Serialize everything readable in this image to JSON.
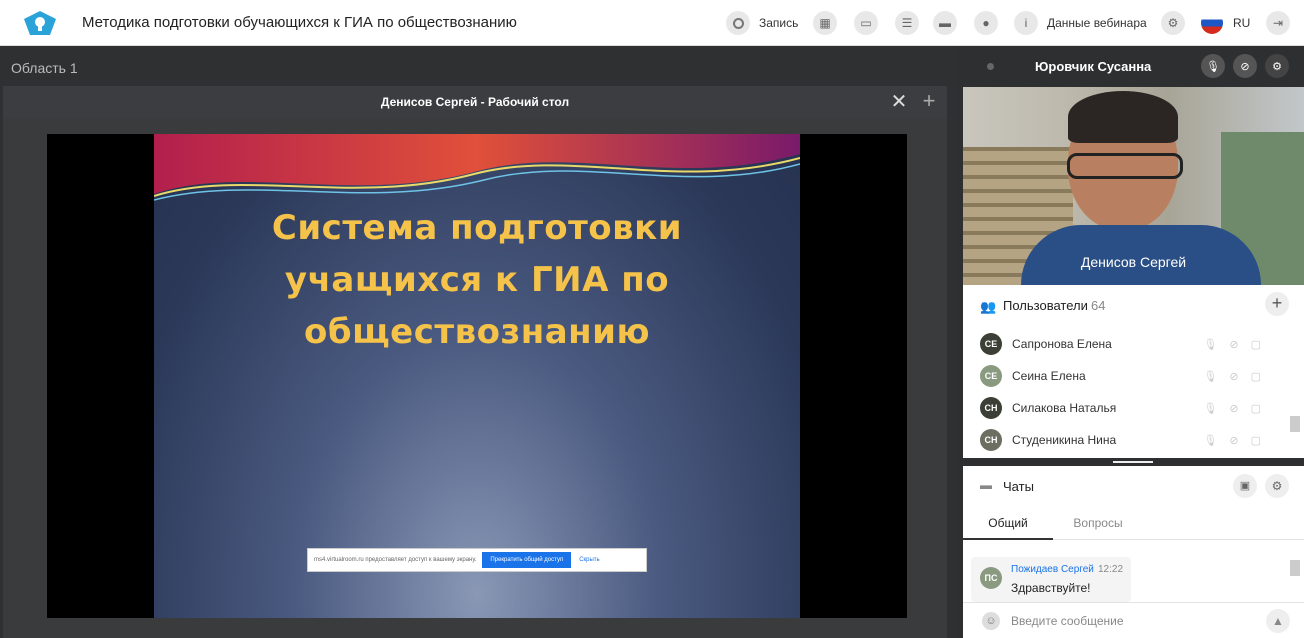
{
  "topbar": {
    "title": "Методика подготовки обучающихся к ГИА по обществознанию",
    "record_label": "Запись",
    "webinar_data_label": "Данные вебинара",
    "lang": "RU"
  },
  "area": {
    "label": "Область 1",
    "window_title": "Денисов Сергей - Рабочий стол"
  },
  "slide": {
    "title_line1": "Система подготовки",
    "title_line2": "учащихся к ГИА по",
    "title_line3": "обществознанию"
  },
  "share_bar": {
    "text": "ms4.virtualroom.ru предоставляет доступ к вашему экрану.",
    "stop_label": "Прекратить общий доступ",
    "hide_label": "Скрыть"
  },
  "presenter": {
    "name": "Юровчик Сусанна",
    "video_label": "Денисов Сергей"
  },
  "users": {
    "label": "Пользователи",
    "count": "64",
    "items": [
      {
        "initials": "СЕ",
        "name": "Сапронова Елена",
        "color": "#3c3f35"
      },
      {
        "initials": "СЕ",
        "name": "Сеина Елена",
        "color": "#8a9a80"
      },
      {
        "initials": "СН",
        "name": "Силакова Наталья",
        "color": "#3c3f35"
      },
      {
        "initials": "СН",
        "name": "Студеникина Нина",
        "color": "#6b6e60"
      }
    ]
  },
  "chats": {
    "label": "Чаты",
    "tab_common": "Общий",
    "tab_questions": "Вопросы",
    "message": {
      "initials": "ПС",
      "author": "Пожидаев Сергей",
      "time": "12:22",
      "text": "Здравствуйте!"
    },
    "input_placeholder": "Введите сообщение"
  }
}
